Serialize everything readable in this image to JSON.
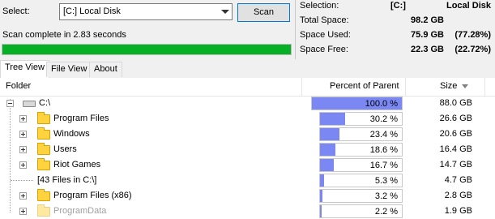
{
  "controls": {
    "select_label": "Select:",
    "drive_value": "[C:] Local Disk",
    "scan_label": "Scan",
    "status_text": "Scan complete in 2.83 seconds",
    "progress_fraction": 1.0,
    "progress_color": "#06b025"
  },
  "info": {
    "selection_label": "Selection:",
    "selection_drive": "[C:]",
    "selection_name": "Local Disk",
    "total_label": "Total Space:",
    "total_value": "98.2 GB",
    "used_label": "Space Used:",
    "used_value": "75.9 GB",
    "used_pct": "(77.28%)",
    "free_label": "Space Free:",
    "free_value": "22.3 GB",
    "free_pct": "(22.72%)"
  },
  "tabs": [
    "Tree View",
    "File View",
    "About"
  ],
  "columns": {
    "folder": "Folder",
    "percent": "Percent of Parent",
    "size": "Size"
  },
  "bar_color": "#7b88f4",
  "rows": [
    {
      "name": "C:\\",
      "percent": "100.0 %",
      "fraction": 1.0,
      "size": "88.0 GB",
      "icon": "disk-icon"
    },
    {
      "name": "Program Files",
      "percent": "30.2 %",
      "fraction": 0.302,
      "size": "26.6 GB",
      "icon": "folder-icon"
    },
    {
      "name": "Windows",
      "percent": "23.4 %",
      "fraction": 0.234,
      "size": "20.6 GB",
      "icon": "folder-icon"
    },
    {
      "name": "Users",
      "percent": "18.6 %",
      "fraction": 0.186,
      "size": "16.4 GB",
      "icon": "folder-icon"
    },
    {
      "name": "Riot Games",
      "percent": "16.7 %",
      "fraction": 0.167,
      "size": "14.7 GB",
      "icon": "folder-icon"
    },
    {
      "name": "[43 Files in C:\\]",
      "percent": "5.3 %",
      "fraction": 0.053,
      "size": "4.7 GB",
      "icon": "none"
    },
    {
      "name": "Program Files (x86)",
      "percent": "3.2 %",
      "fraction": 0.032,
      "size": "2.8 GB",
      "icon": "folder-icon"
    },
    {
      "name": "ProgramData",
      "percent": "2.2 %",
      "fraction": 0.022,
      "size": "1.9 GB",
      "icon": "folder-icon"
    }
  ]
}
